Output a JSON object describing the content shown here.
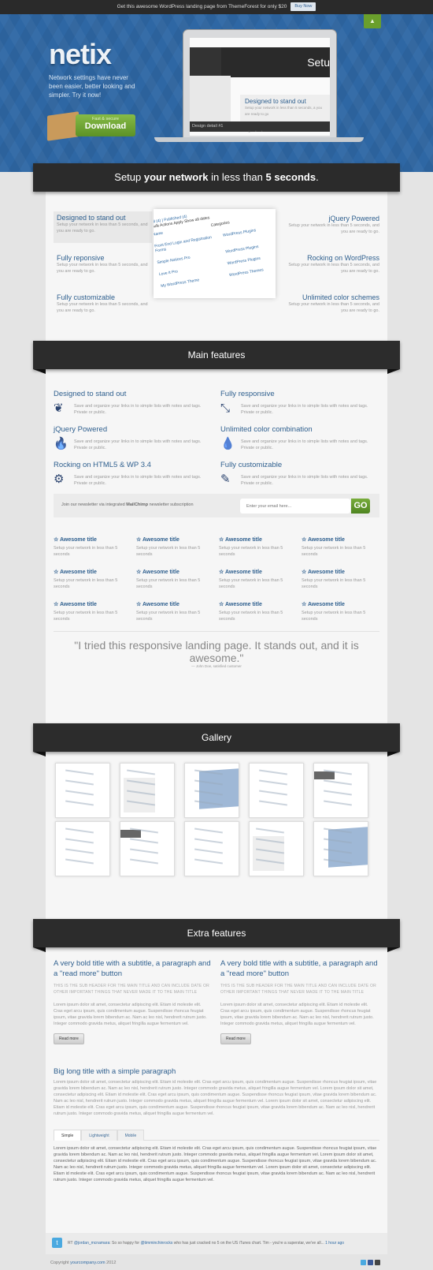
{
  "topbar": {
    "text": "Get this awesome WordPress landing page from ThemeForest for only $20",
    "buy": "Buy Now"
  },
  "hero": {
    "logo": "netix",
    "tagline": "Network settings have never been easier, better looking and simpler. Try it now!",
    "download_small": "Fast & secure",
    "download": "Download",
    "screen_title": "Setu",
    "screen_feature": "Designed to stand out",
    "screen_text": "Setup your network in less than 5 seconds, a you are ready to go",
    "screen_caption": "Design detail #1"
  },
  "intro": {
    "pre": "Setup ",
    "b1": "your network",
    "mid": " in less than ",
    "b2": "5 seconds",
    "post": "."
  },
  "features": {
    "desc": "Setup your network in less than 5 seconds, and you are ready to go.",
    "left": [
      "Designed to stand out",
      "Fully reponsive",
      "Fully customizable"
    ],
    "right": [
      "jQuery Powered",
      "Rocking on WordPress",
      "Unlimited color schemes"
    ],
    "shot": {
      "tabs": "All (4) | Published (4)",
      "bulk": "Bulk Actions",
      "apply": "Apply",
      "show": "Show all dates",
      "col_name": "Name",
      "col_cat": "Categories",
      "rows": [
        [
          "Front End Login and Registration Forms",
          "WordPress Plugins"
        ],
        [
          "Simple Notices Pro",
          "WordPress Plugins"
        ],
        [
          "Love It Pro",
          "WordPress Plugins"
        ],
        [
          "My WordPress Theme",
          "WordPress Themes"
        ]
      ]
    }
  },
  "main": {
    "title": "Main features",
    "desc": "Save and organize your links in to simple lists with notes and tags. Private or public.",
    "items": [
      {
        "title": "Designed to stand out",
        "icon": "leaf-icon"
      },
      {
        "title": "Fully responsive",
        "icon": "compress-icon"
      },
      {
        "title": "jQuery Powered",
        "icon": "fire-icon"
      },
      {
        "title": "Unlimited color combination",
        "icon": "drop-icon"
      },
      {
        "title": "Rocking on HTML5 & WP 3.4",
        "icon": "gear-icon"
      },
      {
        "title": "Fully customizable",
        "icon": "edit-icon"
      }
    ],
    "newsletter": {
      "pre": "Join our newsletter via integrated ",
      "brand": "MailChimp",
      "post": " newsletter subscription",
      "placeholder": "Enter your email here...",
      "go": "GO"
    },
    "awesome_title": "Awesome title",
    "awesome_text": "Setup your network in less than 5 seconds",
    "quote": "\"I tried this responsive landing page. It stands out, and it is awesome.\"",
    "attribution": "— John Doe, satisfied customer"
  },
  "gallery": {
    "title": "Gallery"
  },
  "extra": {
    "title": "Extra features",
    "card_title": "A very bold title with a subtitle, a paragraph and a \"read more\" button",
    "card_sub": "THIS IS THE SUB HEADER FOR THE MAIN TITLE AND CAN INCLUDE DATE OR OTHER IMPORTANT THINGS THAT NEVER MADE IT TO THE MAIN TITLE",
    "card_text": "Lorem ipsum dolor sit amet, consectetur adipiscing elit. Etiam id molestie elit. Cras eget arcu ipsum, quis condimentum augue. Suspendisse rhoncus feugiat ipsum, vitae gravida lorem bibendum ac. Nam ac leo nisl, hendrerit rutrum justo. Integer commodo gravida metus, aliquet fringilla augue fermentum vel.",
    "read_more": "Read more",
    "big_title": "Big long title with a simple paragraph",
    "big_text": "Lorem ipsum dolor sit amet, consectetur adipiscing elit. Etiam id molestie elit. Cras eget arcu ipsum, quis condimentum augue. Suspendisse rhoncus feugiat ipsum, vitae gravida lorem bibendum ac. Nam ac leo nisl, hendrerit rutrum justo. Integer commodo gravida metus, aliquet fringilla augue fermentum vel. Lorem ipsum dolor sit amet, consectetur adipiscing elit. Etiam id molestie elit. Cras eget arcu ipsum, quis condimentum augue. Suspendisse rhoncus feugiat ipsum, vitae gravida lorem bibendum ac. Nam ac leo nisl, hendrerit rutrum justo. Integer commodo gravida metus, aliquet fringilla augue fermentum vel. Lorem ipsum dolor sit amet, consectetur adipiscing elit. Etiam id molestie elit. Cras eget arcu ipsum, quis condimentum augue. Suspendisse rhoncus feugiat ipsum, vitae gravida lorem bibendum ac. Nam ac leo nisl, hendrerit rutrum justo. Integer commodo gravida metus, aliquet fringilla augue fermentum vel.",
    "tabs": [
      "Simple",
      "Lightweight",
      "Mobile"
    ],
    "tab_text": "Lorem ipsum dolor sit amet, consectetur adipiscing elit. Etiam id molestie elit. Cras eget arcu ipsum, quis condimentum augue. Suspendisse rhoncus feugiat ipsum, vitae gravida lorem bibendum ac. Nam ac leo nisl, hendrerit rutrum justo. Integer commodo gravida metus, aliquet fringilla augue fermentum vel. Lorem ipsum dolor sit amet, consectetur adipiscing elit. Etiam id molestie elit. Cras eget arcu ipsum, quis condimentum augue. Suspendisse rhoncus feugiat ipsum, vitae gravida lorem bibendum ac. Nam ac leo nisl, hendrerit rutrum justo. Integer commodo gravida metus, aliquet fringilla augue fermentum vel. Lorem ipsum dolor sit amet, consectetur adipiscing elit. Etiam id molestie elit. Cras eget arcu ipsum, quis condimentum augue. Suspendisse rhoncus feugiat ipsum, vitae gravida lorem bibendum ac. Nam ac leo nisl, hendrerit rutrum justo. Integer commodo gravida metus, aliquet fringilla augue fermentum vel."
  },
  "tweet": {
    "rt": "RT ",
    "user": "@jordan_mcnamara",
    "t1": ": So so happy for ",
    "mention": "@timminchinrocks",
    "t2": " who has just cracked no 5 on the US iTunes chart. Tim - you're a superstar, we've all...",
    "time": "1 hour ago"
  },
  "footer": {
    "pre": "Copyright ",
    "link": "yourcompany.com",
    "year": " 2012"
  },
  "colors": {
    "hero": "#2e67a4",
    "accent": "#2e5f8e",
    "green": "#6a9f2c",
    "dark": "#2b2b2b"
  }
}
